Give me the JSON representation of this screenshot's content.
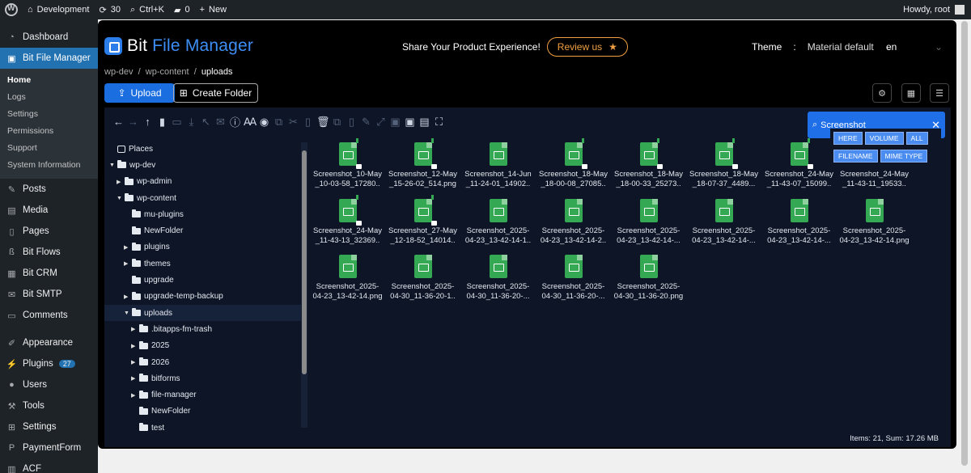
{
  "admin_bar": {
    "site": "Development",
    "updates": "30",
    "shortcut": "Ctrl+K",
    "comments": "0",
    "new": "New",
    "greeting": "Howdy, root"
  },
  "sidebar": {
    "dashboard": "Dashboard",
    "active": "Bit File Manager",
    "submenu": [
      "Home",
      "Logs",
      "Settings",
      "Permissions",
      "Support",
      "System Information"
    ],
    "items": [
      "Posts",
      "Media",
      "Pages",
      "Bit Flows",
      "Bit CRM",
      "Bit SMTP",
      "Comments",
      "Appearance",
      "Plugins",
      "Users",
      "Tools",
      "Settings",
      "PaymentForm",
      "ACF"
    ],
    "plugins_badge": "27"
  },
  "header": {
    "logo_a": "Bit ",
    "logo_b": "File Manager",
    "promo": "Share Your Product Experience!",
    "review": "Review us",
    "theme_label": "Theme",
    "theme_sep": ":",
    "theme_value": "Material default",
    "lang": "en"
  },
  "breadcrumb": {
    "a": "wp-dev",
    "sep": "/",
    "b": "wp-content",
    "c": "uploads"
  },
  "actions": {
    "upload": "Upload",
    "create_folder": "Create Folder"
  },
  "search": {
    "value": "Screenshot",
    "options": [
      "HERE",
      "VOLUME",
      "ALL",
      "FILENAME",
      "MIME TYPE"
    ]
  },
  "tree": [
    {
      "label": "Places",
      "depth": 0,
      "caret": "",
      "icon": "hd"
    },
    {
      "label": "wp-dev",
      "depth": 0,
      "caret": "▼",
      "icon": "folder"
    },
    {
      "label": "wp-admin",
      "depth": 1,
      "caret": "▶",
      "icon": "folder"
    },
    {
      "label": "wp-content",
      "depth": 1,
      "caret": "▼",
      "icon": "folder"
    },
    {
      "label": "mu-plugins",
      "depth": 2,
      "caret": "",
      "icon": "folder"
    },
    {
      "label": "NewFolder",
      "depth": 2,
      "caret": "",
      "icon": "folder"
    },
    {
      "label": "plugins",
      "depth": 2,
      "caret": "▶",
      "icon": "folder"
    },
    {
      "label": "themes",
      "depth": 2,
      "caret": "▶",
      "icon": "folder"
    },
    {
      "label": "upgrade",
      "depth": 2,
      "caret": "",
      "icon": "folder"
    },
    {
      "label": "upgrade-temp-backup",
      "depth": 2,
      "caret": "▶",
      "icon": "folder"
    },
    {
      "label": "uploads",
      "depth": 2,
      "caret": "▼",
      "icon": "folder",
      "selected": true
    },
    {
      "label": ".bitapps-fm-trash",
      "depth": 3,
      "caret": "▶",
      "icon": "folder"
    },
    {
      "label": "2025",
      "depth": 3,
      "caret": "▶",
      "icon": "folder"
    },
    {
      "label": "2026",
      "depth": 3,
      "caret": "▶",
      "icon": "folder"
    },
    {
      "label": "bitforms",
      "depth": 3,
      "caret": "▶",
      "icon": "folder"
    },
    {
      "label": "file-manager",
      "depth": 3,
      "caret": "▶",
      "icon": "folder"
    },
    {
      "label": "NewFolder",
      "depth": 3,
      "caret": "",
      "icon": "folder"
    },
    {
      "label": "test",
      "depth": 3,
      "caret": "",
      "icon": "folder"
    }
  ],
  "files": [
    {
      "l1": "Screenshot_10-May",
      "l2": "_10-03-58_17280..",
      "locked": true
    },
    {
      "l1": "Screenshot_12-May",
      "l2": "_15-26-02_514.png",
      "locked": true
    },
    {
      "l1": "Screenshot_14-Jun",
      "l2": "_11-24-01_14902..",
      "locked": false
    },
    {
      "l1": "Screenshot_18-May",
      "l2": "_18-00-08_27085..",
      "locked": true
    },
    {
      "l1": "Screenshot_18-May",
      "l2": "_18-00-33_25273..",
      "locked": true
    },
    {
      "l1": "Screenshot_18-May",
      "l2": "_18-07-37_4489...",
      "locked": true
    },
    {
      "l1": "Screenshot_24-May",
      "l2": "_11-43-07_15099..",
      "locked": true
    },
    {
      "l1": "Screenshot_24-May",
      "l2": "_11-43-11_19533..",
      "locked": false
    },
    {
      "l1": "Screenshot_24-May",
      "l2": "_11-43-13_32369..",
      "locked": true
    },
    {
      "l1": "Screenshot_27-May",
      "l2": "_12-18-52_14014..",
      "locked": true
    },
    {
      "l1": "Screenshot_2025-",
      "l2": "04-23_13-42-14-1..",
      "locked": false
    },
    {
      "l1": "Screenshot_2025-",
      "l2": "04-23_13-42-14-2..",
      "locked": false
    },
    {
      "l1": "Screenshot_2025-",
      "l2": "04-23_13-42-14-...",
      "locked": false
    },
    {
      "l1": "Screenshot_2025-",
      "l2": "04-23_13-42-14-...",
      "locked": false
    },
    {
      "l1": "Screenshot_2025-",
      "l2": "04-23_13-42-14-...",
      "locked": false
    },
    {
      "l1": "Screenshot_2025-",
      "l2": "04-23_13-42-14.png",
      "locked": false
    },
    {
      "l1": "Screenshot_2025-",
      "l2": "04-23_13-42-14.png",
      "locked": false
    },
    {
      "l1": "Screenshot_2025-",
      "l2": "04-30_11-36-20-1..",
      "locked": false
    },
    {
      "l1": "Screenshot_2025-",
      "l2": "04-30_11-36-20-...",
      "locked": false
    },
    {
      "l1": "Screenshot_2025-",
      "l2": "04-30_11-36-20-...",
      "locked": false
    },
    {
      "l1": "Screenshot_2025-",
      "l2": "04-30_11-36-20.png",
      "locked": false
    }
  ],
  "status": "Items: 21, Sum: 17.26 MB"
}
